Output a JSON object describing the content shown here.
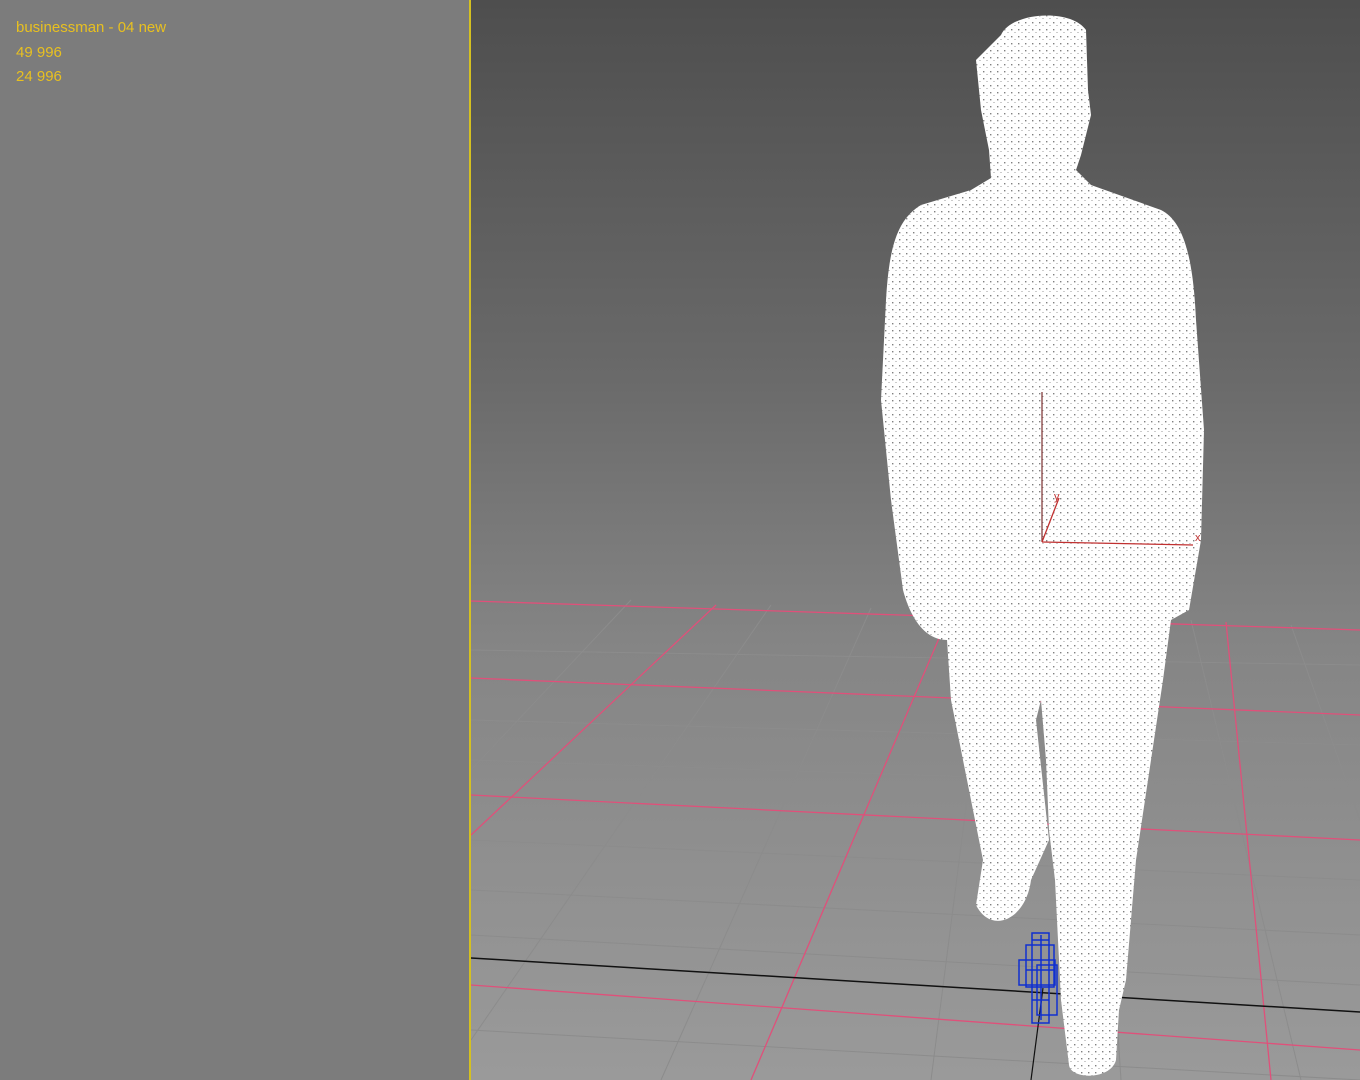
{
  "viewport_info": {
    "object_name": "businessman - 04 new",
    "vertex_count": "49 996",
    "face_count": "24 996"
  },
  "gizmo": {
    "x_axis_label": "x",
    "y_axis_label": "y"
  },
  "colors": {
    "stats_text": "#e8c020",
    "viewport_divider": "#d4c020",
    "grid_major": "#e0507a",
    "grid_minor": "#8c8c8c",
    "model_points": "#ffffff",
    "transform_x_axis": "#c03030",
    "transform_gizmo": "#1030d0"
  },
  "icons": {
    "pivot_gizmo": "pivot-axis-icon",
    "camera_object": "camera-wireframe-icon"
  }
}
